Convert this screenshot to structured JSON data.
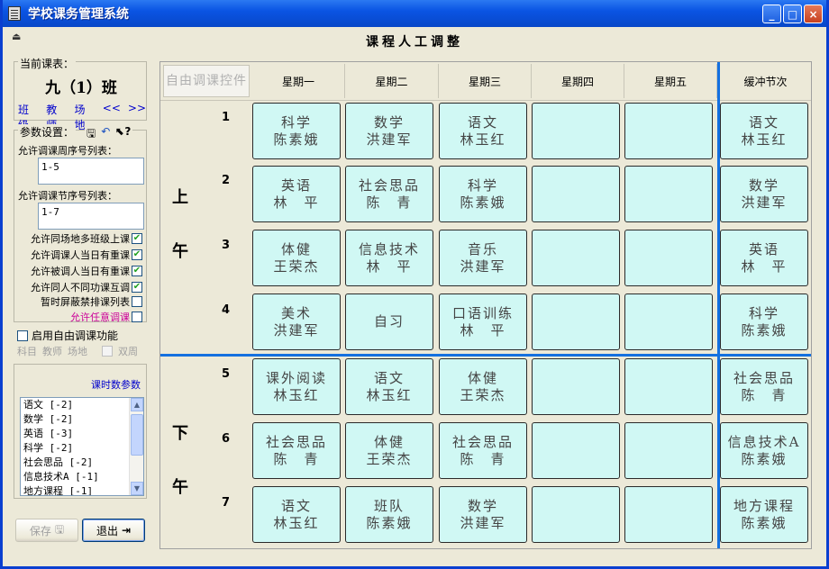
{
  "window": {
    "title": "学校课务管理系统",
    "buttons": [
      "_",
      "□",
      "×"
    ]
  },
  "heading": "课程人工调整",
  "current": {
    "legend": "当前课表：",
    "class_name": "九（1）班",
    "nav": [
      "班级",
      "教师",
      "场地",
      "<<",
      ">>"
    ]
  },
  "params": {
    "legend": "参数设置：",
    "week_label": "允许调课周序号列表：",
    "week_value": "1-5",
    "period_label": "允许调课节序号列表：",
    "period_value": "1-7",
    "options": [
      {
        "label": "允许同场地多班级上课",
        "checked": true
      },
      {
        "label": "允许调课人当日有重课",
        "checked": true
      },
      {
        "label": "允许被调人当日有重课",
        "checked": true
      },
      {
        "label": "允许同人不同功课互调",
        "checked": true
      },
      {
        "label": "暂时屏蔽禁排课列表",
        "checked": false
      },
      {
        "label": "允许任意调课",
        "checked": false,
        "color": "#cc0099"
      }
    ]
  },
  "free": {
    "label": "启用自由调课功能",
    "sub": [
      "科目",
      "教师",
      "场地"
    ],
    "double_week": "双周"
  },
  "hours": {
    "title": "课时数参数",
    "items": [
      "语文 [-2]",
      "数学 [-2]",
      "英语 [-3]",
      "科学 [-2]",
      "社会思品 [-2]",
      "信息技术A [-1]",
      "地方课程 [-1]"
    ]
  },
  "buttons": {
    "save": "保存",
    "exit": "退出"
  },
  "grid": {
    "free_button": "自由调课控件",
    "days": [
      "星期一",
      "星期二",
      "星期三",
      "星期四",
      "星期五"
    ],
    "buffer": "缓冲节次",
    "morning": [
      "上",
      "午"
    ],
    "afternoon": [
      "下",
      "午"
    ],
    "periods": [
      "1",
      "2",
      "3",
      "4",
      "5",
      "6",
      "7"
    ],
    "rows": [
      {
        "cells": [
          [
            "科学",
            "陈素娥"
          ],
          [
            "数学",
            "洪建军"
          ],
          [
            "语文",
            "林玉红"
          ],
          [
            "",
            ""
          ],
          [
            "",
            ""
          ]
        ],
        "buffer": [
          "语文",
          "林玉红"
        ]
      },
      {
        "cells": [
          [
            "英语",
            "林　平"
          ],
          [
            "社会思品",
            "陈　青"
          ],
          [
            "科学",
            "陈素娥"
          ],
          [
            "",
            ""
          ],
          [
            "",
            ""
          ]
        ],
        "buffer": [
          "数学",
          "洪建军"
        ]
      },
      {
        "cells": [
          [
            "体健",
            "王荣杰"
          ],
          [
            "信息技术",
            "林　平"
          ],
          [
            "音乐",
            "洪建军"
          ],
          [
            "",
            ""
          ],
          [
            "",
            ""
          ]
        ],
        "buffer": [
          "英语",
          "林　平"
        ]
      },
      {
        "cells": [
          [
            "美术",
            "洪建军"
          ],
          [
            "自习",
            ""
          ],
          [
            "口语训练",
            "林　平"
          ],
          [
            "",
            ""
          ],
          [
            "",
            ""
          ]
        ],
        "buffer": [
          "科学",
          "陈素娥"
        ]
      },
      {
        "cells": [
          [
            "课外阅读",
            "林玉红"
          ],
          [
            "语文",
            "林玉红"
          ],
          [
            "体健",
            "王荣杰"
          ],
          [
            "",
            ""
          ],
          [
            "",
            ""
          ]
        ],
        "buffer": [
          "社会思品",
          "陈　青"
        ]
      },
      {
        "cells": [
          [
            "社会思品",
            "陈　青"
          ],
          [
            "体健",
            "王荣杰"
          ],
          [
            "社会思品",
            "陈　青"
          ],
          [
            "",
            ""
          ],
          [
            "",
            ""
          ]
        ],
        "buffer": [
          "信息技术A",
          "陈素娥"
        ]
      },
      {
        "cells": [
          [
            "语文",
            "林玉红"
          ],
          [
            "班队",
            "陈素娥"
          ],
          [
            "数学",
            "洪建军"
          ],
          [
            "",
            ""
          ],
          [
            "",
            ""
          ]
        ],
        "buffer": [
          "地方课程",
          "陈素娥"
        ]
      }
    ]
  },
  "colors": {
    "title_bar": "#0a54e3",
    "cell": "#d0f8f4",
    "divider": "#1470e0",
    "link": "#0000cc"
  }
}
